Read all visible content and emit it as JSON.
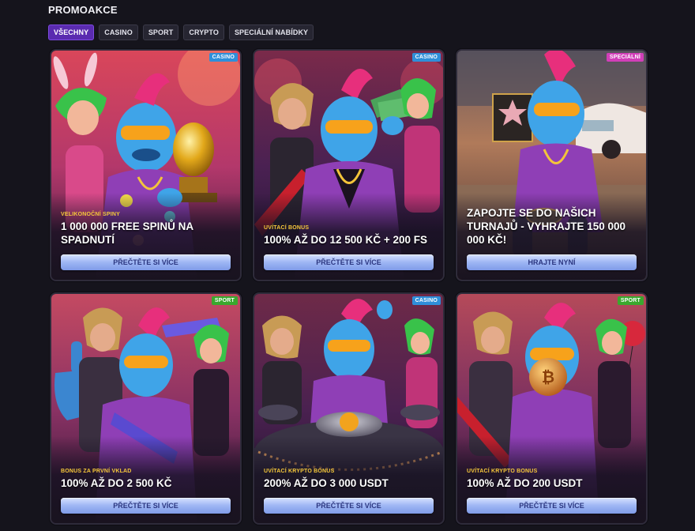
{
  "page": {
    "title": "PROMOAKCE"
  },
  "filters": [
    {
      "label": "VŠECHNY",
      "active": true
    },
    {
      "label": "CASINO",
      "active": false
    },
    {
      "label": "SPORT",
      "active": false
    },
    {
      "label": "CRYPTO",
      "active": false
    },
    {
      "label": "SPECIÁLNÍ NABÍDKY",
      "active": false
    }
  ],
  "cards": [
    {
      "badge": "CASINO",
      "subtitle": "VELIKONOČNÍ SPINY",
      "headline": "1 000 000 FREE SPINŮ NA SPADNUTÍ",
      "button": "PŘEČTĚTE SI VÍCE"
    },
    {
      "badge": "CASINO",
      "subtitle": "UVÍTACÍ BONUS",
      "headline": "100% AŽ DO 12 500 KČ + 200 FS",
      "button": "PŘEČTĚTE SI VÍCE"
    },
    {
      "badge": "SPECIÁLNÍ",
      "subtitle": "",
      "headline": "ZAPOJTE SE DO NAŠICH TURNAJŮ - VYHRAJTE 150 000 000 KČ!",
      "button": "HRAJTE NYNÍ"
    },
    {
      "badge": "SPORT",
      "subtitle": "BONUS ZA PRVNÍ VKLAD",
      "headline": "100% AŽ DO 2 500 KČ",
      "button": "PŘEČTĚTE SI VÍCE"
    },
    {
      "badge": "CASINO",
      "subtitle": "UVÍTACÍ KRYPTO BONUS",
      "headline": "200% AŽ DO 3 000 USDT",
      "button": "PŘEČTĚTE SI VÍCE"
    },
    {
      "badge": "SPORT",
      "subtitle": "UVÍTACÍ KRYPTO BONUS",
      "headline": "100% AŽ DO 200 USDT",
      "button": "PŘEČTĚTE SI VÍCE"
    }
  ],
  "badge_colors": {
    "CASINO": "#2f8fd9",
    "SPECIÁLNÍ": "#d13fb8",
    "SPORT": "#3aa82e"
  },
  "accent": "#5a2bb0"
}
